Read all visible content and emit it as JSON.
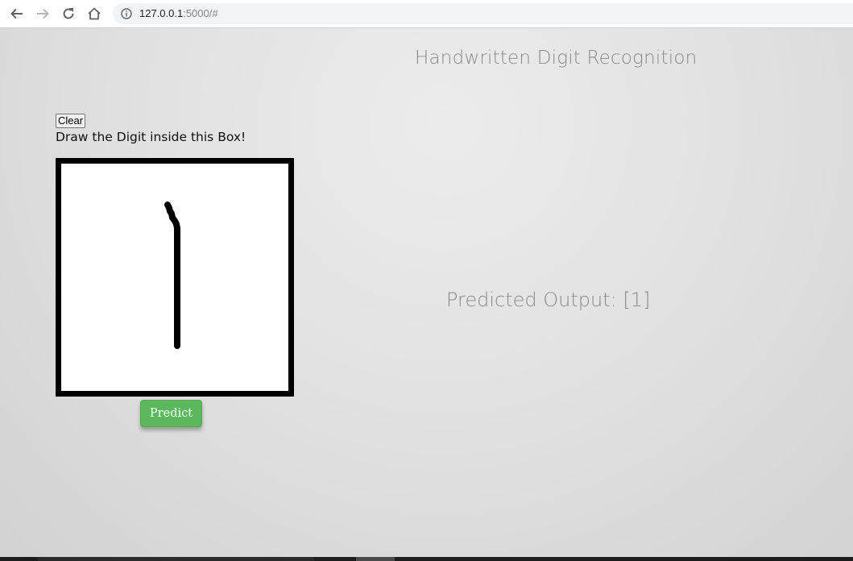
{
  "browser": {
    "url_host": "127.0.0.1",
    "url_path": ":5000/#",
    "icons": {
      "back": "back-arrow-icon",
      "forward": "forward-arrow-icon",
      "reload": "reload-icon",
      "home": "home-icon",
      "info": "info-icon"
    }
  },
  "page": {
    "title": "Handwritten Digit Recognition",
    "clear_label": "Clear",
    "instructions": "Draw the Digit inside this Box!",
    "predict_label": "Predict",
    "result_text": "Predicted Output: [1]"
  },
  "colors": {
    "predict_button": "#5cb85c",
    "canvas_border": "#000000",
    "title_text": "#8a8a8a"
  }
}
